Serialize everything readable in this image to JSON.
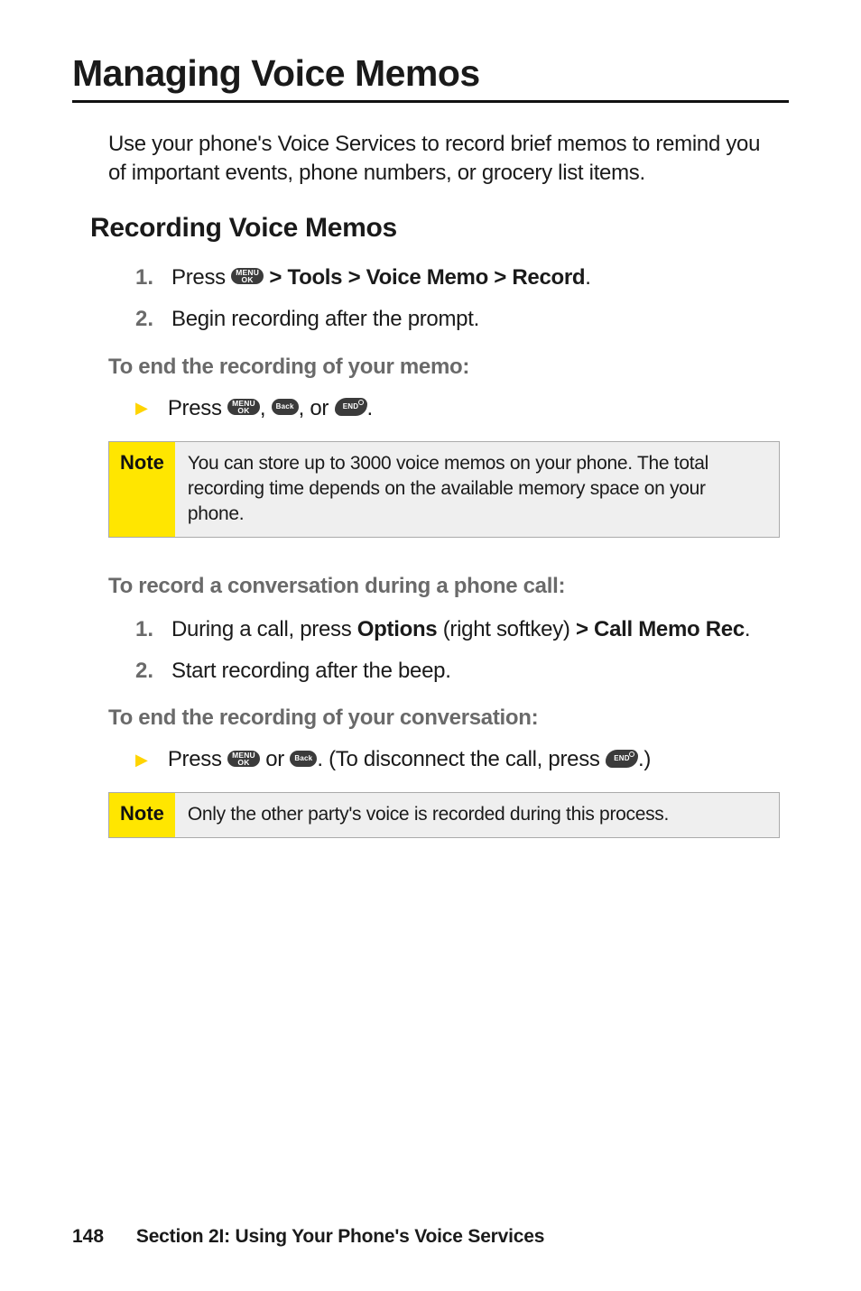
{
  "title": "Managing Voice Memos",
  "intro": "Use your phone's Voice Services to record brief memos to remind you of important events, phone numbers, or grocery list items.",
  "sub1": "Recording Voice Memos",
  "step1_prefix": "Press ",
  "step1_bold": " > Tools > Voice Memo > Record",
  "step1_suffix": ".",
  "step2": "Begin recording after the prompt.",
  "endMemoHead": "To end the recording of your memo:",
  "endMemo_prefix": "Press ",
  "endMemo_mid1": ", ",
  "endMemo_mid2": ", or ",
  "endMemo_suffix": ".",
  "note1_label": "Note",
  "note1_text": "You can store up to 3000 voice memos on your phone. The total recording time depends on the available memory space on your phone.",
  "convHead": "To record a conversation during a phone call:",
  "conv1_prefix": "During a call, press ",
  "conv1_bold1": "Options",
  "conv1_mid": " (right softkey) ",
  "conv1_bold2": "> Call Memo Rec",
  "conv1_suffix": ".",
  "conv2": "Start recording after the beep.",
  "endConvHead": "To end the recording of your conversation:",
  "endConv_prefix": "Press ",
  "endConv_mid1": " or ",
  "endConv_mid2": ". (To disconnect the call, press ",
  "endConv_suffix": ".)",
  "note2_label": "Note",
  "note2_text": "Only the other party's voice is recorded during this process.",
  "key_menu": "MENU\nOK",
  "key_back": "Back",
  "key_end": "END",
  "footer_page": "148",
  "footer_section": "Section 2I: Using Your Phone's Voice Services"
}
